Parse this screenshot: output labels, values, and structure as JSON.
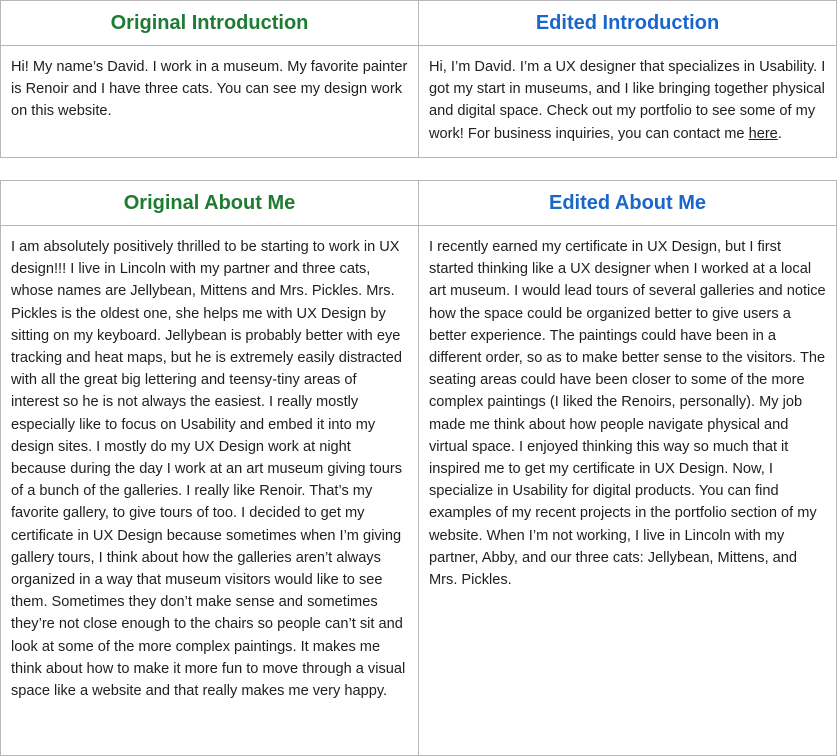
{
  "colors": {
    "original_header": "#1e7b34",
    "edited_header": "#1a66c9"
  },
  "introduction": {
    "original_title": "Original Introduction",
    "edited_title": "Edited Introduction",
    "original_text": "Hi! My name’s David. I work in a museum. My favorite painter is Renoir and I have three cats. You can see my design work on this website.",
    "edited_text_before_link": "Hi, I’m David. I’m a UX designer that specializes in Usability. I got my start in museums, and I like bringing together physical and digital space. Check out my portfolio to see some of my work! For business inquiries, you can contact me ",
    "edited_link": "here",
    "edited_text_after_link": "."
  },
  "about_me": {
    "original_title": "Original About Me",
    "edited_title": "Edited About Me",
    "original_text": "I am absolutely positively thrilled to be starting to work in UX design!!! I live in Lincoln with my partner and three cats, whose names are Jellybean, Mittens and Mrs. Pickles. Mrs. Pickles is the oldest one, she helps me with UX Design by sitting on my keyboard. Jellybean is probably better with eye tracking and heat maps, but he is extremely easily distracted with all the great big lettering and teensy-tiny areas of interest so he is not always the easiest. I really mostly especially like to focus on Usability and embed it into my design sites. I mostly do my UX Design work at night because during the day I work at an art museum giving tours of a bunch of the galleries. I really like Renoir. That’s my favorite gallery, to give tours of too. I decided to get my certificate in UX Design because sometimes when I’m giving gallery tours, I think about how the galleries aren’t always organized in a way that museum visitors would like to see them. Sometimes they don’t make sense and sometimes they’re not close enough to the chairs so people can’t sit and look at some of the more complex paintings. It makes me think about how to make it more fun to move through a visual space like a website and that really makes me very happy.",
    "edited_text": "I recently earned my certificate in UX Design, but I first started thinking like a UX designer when I worked at a local art museum. I would lead tours of several galleries and notice how the space could be organized better to give users a better experience. The paintings could have been in a different order, so as to make better sense to the visitors. The seating areas could have been closer to some of the more complex paintings (I liked the Renoirs, personally). My job made me think about how people navigate physical and virtual space. I enjoyed thinking this way so much that it inspired me to get my certificate in UX Design. Now, I specialize in Usability for digital products. You can find examples of my recent projects in the portfolio section of my website. When I’m not working, I live in Lincoln with my partner, Abby, and our three cats: Jellybean, Mittens, and Mrs. Pickles."
  }
}
